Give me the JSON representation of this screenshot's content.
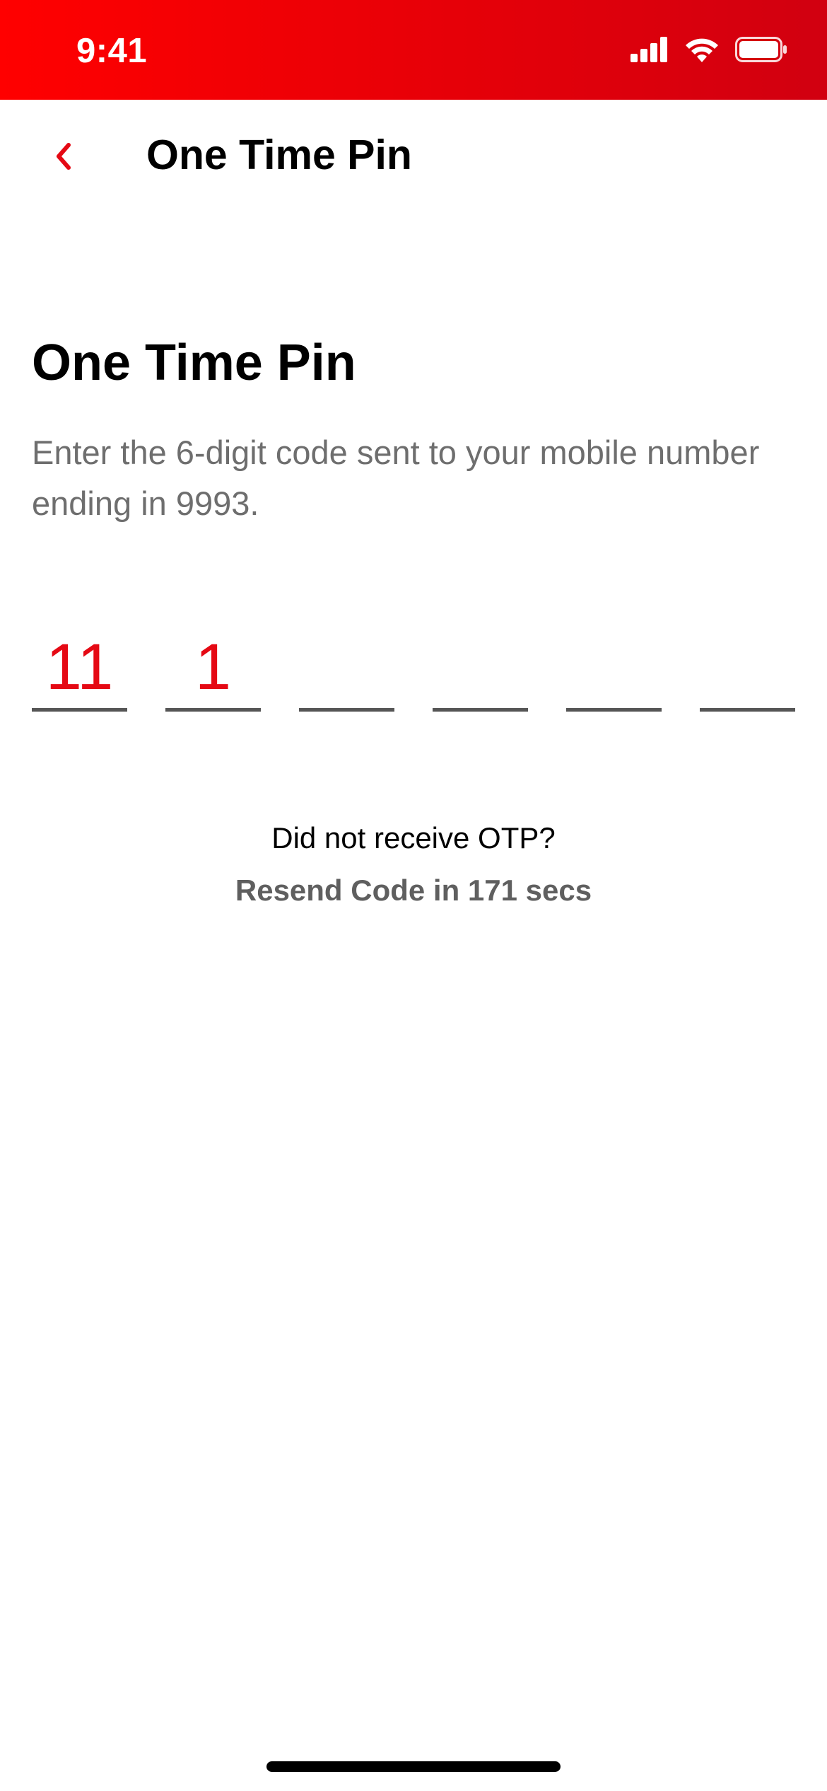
{
  "status_bar": {
    "time": "9:41",
    "background_color": "#e60008",
    "icons": [
      "cellular-signal-icon",
      "wifi-icon",
      "battery-icon"
    ]
  },
  "nav": {
    "back_icon": "chevron-left-icon",
    "title": "One Time Pin"
  },
  "main": {
    "title": "One Time Pin",
    "description": "Enter the 6-digit code sent to your mobile number ending in 9993.",
    "otp": {
      "digits": [
        "11",
        "1",
        "",
        "",
        "",
        ""
      ],
      "digit_color": "#e50914",
      "underline_color": "#555555"
    },
    "resend": {
      "question": "Did not receive OTP?",
      "timer_text": "Resend Code in 171 secs"
    }
  },
  "theme": {
    "accent": "#e50914",
    "text_primary": "#000000",
    "text_secondary": "#6e6e6e"
  }
}
